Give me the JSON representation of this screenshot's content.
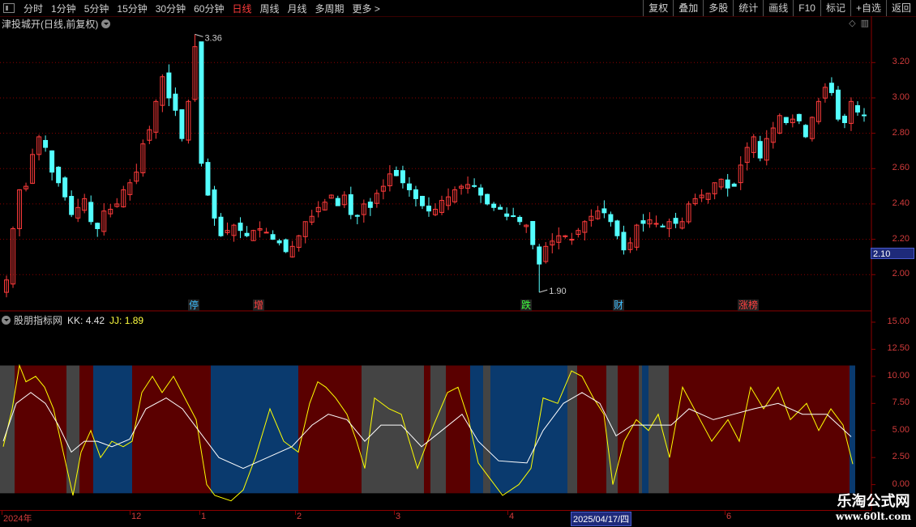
{
  "toolbar": {
    "periods": [
      "分时",
      "1分钟",
      "5分钟",
      "15分钟",
      "30分钟",
      "60分钟",
      "日线",
      "周线",
      "月线",
      "多周期",
      "更多 >"
    ],
    "active_period": "日线",
    "buttons": [
      "复权",
      "叠加",
      "多股",
      "统计",
      "画线",
      "F10",
      "标记",
      "+自选",
      "返回"
    ]
  },
  "stock_title": "津投城开(日线,前复权)",
  "price_axis": [
    "3.20",
    "3.00",
    "2.80",
    "2.60",
    "2.40",
    "2.20",
    "2.00"
  ],
  "current_price": "2.10",
  "high_label": "3.36",
  "low_label": "1.90",
  "events": [
    {
      "text": "停",
      "color": "#3fbfff"
    },
    {
      "text": "增",
      "color": "#ff4040"
    },
    {
      "text": "跌",
      "color": "#40ff40"
    },
    {
      "text": "财",
      "color": "#3fbfff"
    },
    {
      "text": "涨榜",
      "color": "#ff4040"
    }
  ],
  "indicator": {
    "name": "股朋指标网",
    "kk": "KK: 4.42",
    "jj": "JJ: 1.89",
    "axis": [
      "15.00",
      "12.50",
      "10.00",
      "7.50",
      "5.00",
      "2.50",
      "0.00"
    ]
  },
  "date_axis": [
    "2024年",
    "12",
    "1",
    "2",
    "3",
    "4",
    "6"
  ],
  "date_highlight": "2025/04/17/四",
  "watermark": {
    "name": "乐淘公式网",
    "url": "www.60lt.com"
  },
  "colors": {
    "up": "#ff3b3b",
    "down": "#54ffff",
    "bg": "#000000",
    "grid": "#8b0000",
    "band_red": "#5a0000",
    "band_blue": "#0a3a6e",
    "band_gray": "#444444",
    "kk_line": "#ffffff",
    "jj_line": "#ffff00"
  },
  "chart_data": [
    {
      "type": "candlestick",
      "title": "津投城开(日线,前复权)",
      "ylim": [
        1.85,
        3.38
      ],
      "high": 3.36,
      "low": 1.9,
      "last": 2.1,
      "closes": [
        1.97,
        2.26,
        2.48,
        2.5,
        2.68,
        2.78,
        2.72,
        2.58,
        2.52,
        2.44,
        2.34,
        2.38,
        2.43,
        2.3,
        2.26,
        2.36,
        2.37,
        2.4,
        2.48,
        2.52,
        2.58,
        2.74,
        2.82,
        2.98,
        3.12,
        3.0,
        2.93,
        2.77,
        2.98,
        3.29,
        2.63,
        2.45,
        2.32,
        2.22,
        2.25,
        2.28,
        2.25,
        2.22,
        2.25,
        2.26,
        2.24,
        2.2,
        2.18,
        2.13,
        2.16,
        2.22,
        2.3,
        2.33,
        2.38,
        2.41,
        2.45,
        2.39,
        2.45,
        2.34,
        2.33,
        2.4,
        2.38,
        2.46,
        2.5,
        2.57,
        2.56,
        2.52,
        2.48,
        2.43,
        2.39,
        2.36,
        2.37,
        2.42,
        2.44,
        2.48,
        2.5,
        2.51,
        2.5,
        2.45,
        2.4,
        2.38,
        2.37,
        2.33,
        2.33,
        2.3,
        2.28,
        2.17,
        2.06,
        2.16,
        2.19,
        2.22,
        2.22,
        2.2,
        2.25,
        2.3,
        2.33,
        2.36,
        2.35,
        2.3,
        2.22,
        2.14,
        2.18,
        2.28,
        2.29,
        2.31,
        2.29,
        2.27,
        2.3,
        2.29,
        2.3,
        2.4,
        2.43,
        2.45,
        2.46,
        2.52,
        2.54,
        2.49,
        2.5,
        2.62,
        2.72,
        2.78,
        2.66,
        2.77,
        2.83,
        2.9,
        2.86,
        2.88,
        2.87,
        2.78,
        2.89,
        2.98,
        3.06,
        3.03,
        2.88,
        2.86,
        2.98,
        2.92,
        2.9
      ]
    },
    {
      "type": "line",
      "title": "股朋指标网",
      "ylim": [
        -1,
        15
      ],
      "series": [
        {
          "name": "KK",
          "last": 4.42
        },
        {
          "name": "JJ",
          "last": 1.89
        }
      ]
    }
  ]
}
